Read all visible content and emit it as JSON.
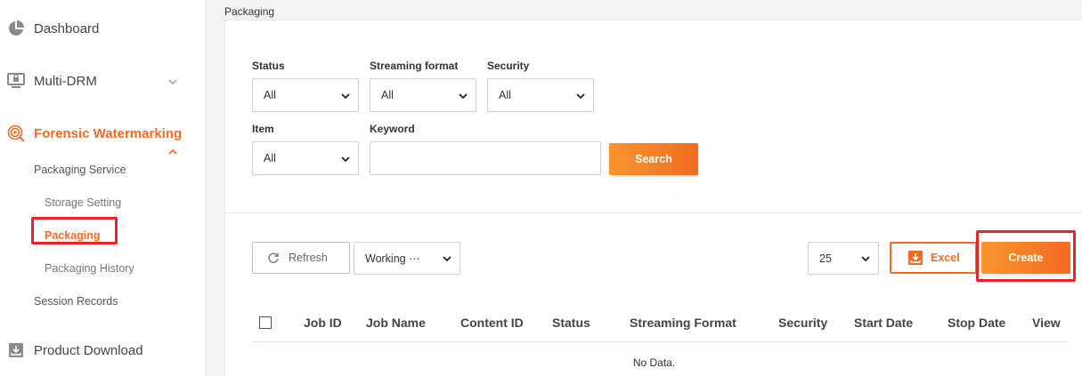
{
  "sidebar": {
    "items": [
      {
        "label": "Dashboard",
        "icon": "pie-chart-icon"
      },
      {
        "label": "Multi-DRM",
        "icon": "monitor-lock-icon"
      },
      {
        "label": "Forensic Watermarking",
        "icon": "target-icon"
      },
      {
        "label": "Product Download",
        "icon": "download-icon"
      }
    ],
    "sub_items": {
      "packaging_service": "Packaging Service",
      "storage_setting": "Storage Setting",
      "packaging": "Packaging",
      "packaging_history": "Packaging History",
      "session_records": "Session Records"
    }
  },
  "breadcrumb": "Packaging",
  "filters": {
    "status": {
      "label": "Status",
      "value": "All"
    },
    "streaming_format": {
      "label": "Streaming format",
      "value": "All"
    },
    "security": {
      "label": "Security",
      "value": "All"
    },
    "item": {
      "label": "Item",
      "value": "All"
    },
    "keyword": {
      "label": "Keyword",
      "value": "",
      "placeholder": ""
    },
    "search_label": "Search"
  },
  "toolbar": {
    "refresh_label": "Refresh",
    "working_value": "Working ···",
    "page_size": "25",
    "excel_label": "Excel",
    "create_label": "Create"
  },
  "table": {
    "columns": [
      "Job ID",
      "Job Name",
      "Content ID",
      "Status",
      "Streaming Format",
      "Security",
      "Start Date",
      "Stop Date",
      "View"
    ],
    "empty_text": "No Data."
  },
  "colors": {
    "accent": "#f36b22",
    "highlight": "#e8232a"
  }
}
